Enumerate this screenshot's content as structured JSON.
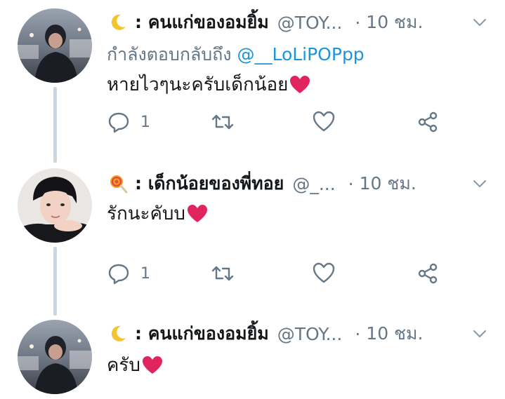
{
  "colors": {
    "accent": "#1b95e0",
    "secondary_text": "#657786",
    "thread_line": "#ccd6dd",
    "heart": "#e0245e"
  },
  "tweets": [
    {
      "emoji": "crescent-moon",
      "display_name": ": คนแก่ของอมยิ้ม",
      "handle": "@TOY...",
      "dot": "·",
      "time": "10 ชม.",
      "reply_prefix": "กำลังตอบกลับถึง",
      "reply_mention": "@__LoLiPOPpp",
      "text": "หายไวๆนะครับเด็กน้อย",
      "reply_count": "1"
    },
    {
      "emoji": "lollipop",
      "display_name": ": เด็กน้อยของพี่ทอย",
      "handle": "@_...",
      "dot": "·",
      "time": "10 ชม.",
      "text": "รักนะคับบ",
      "reply_count": "1"
    },
    {
      "emoji": "crescent-moon",
      "display_name": ": คนแก่ของอมยิ้ม",
      "handle": "@TOY...",
      "dot": "·",
      "time": "10 ชม.",
      "text": "ครับ"
    }
  ]
}
